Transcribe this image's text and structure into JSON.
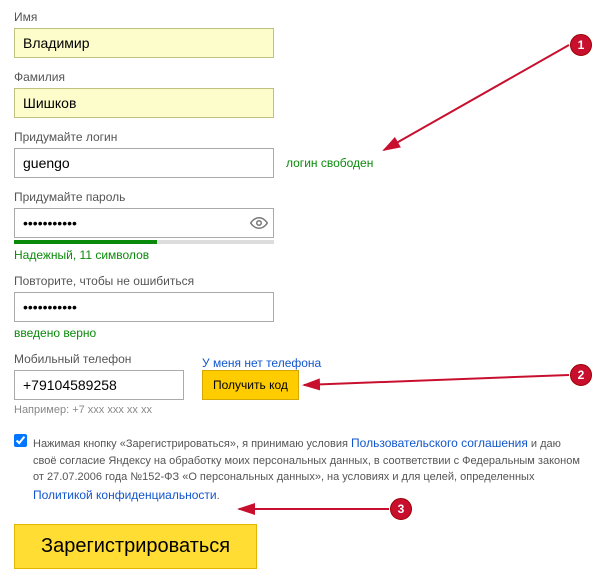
{
  "labels": {
    "first_name": "Имя",
    "last_name": "Фамилия",
    "login": "Придумайте логин",
    "password": "Придумайте пароль",
    "password_confirm": "Повторите, чтобы не ошибиться",
    "phone": "Мобильный телефон"
  },
  "values": {
    "first_name": "Владимир",
    "last_name": "Шишков",
    "login": "guengo",
    "password": "•••••••••••",
    "password_confirm": "•••••••••••",
    "phone": "+79104589258"
  },
  "status": {
    "login_free": "логин свободен",
    "password_strength": "Надежный, 11 символов",
    "confirm_ok": "введено верно"
  },
  "phone": {
    "no_phone_link": "У меня нет телефона",
    "get_code_btn": "Получить код",
    "hint": "Например: +7 xxx xxx xx xx"
  },
  "consent": {
    "prefix": "Нажимая кнопку «Зарегистрироваться», я принимаю условия ",
    "link1": "Пользовательского соглашения",
    "mid1": " и даю своё согласие Яндексу на обработку моих персональных данных, в соответствии с Федеральным законом от 27.07.2006 года №152-ФЗ «О персональных данных», на условиях и для целей, определенных ",
    "link2": "Политикой конфиденциальности",
    "suffix": "."
  },
  "register_btn": "Зарегистрироваться",
  "annotations": {
    "a1": "1",
    "a2": "2",
    "a3": "3"
  }
}
